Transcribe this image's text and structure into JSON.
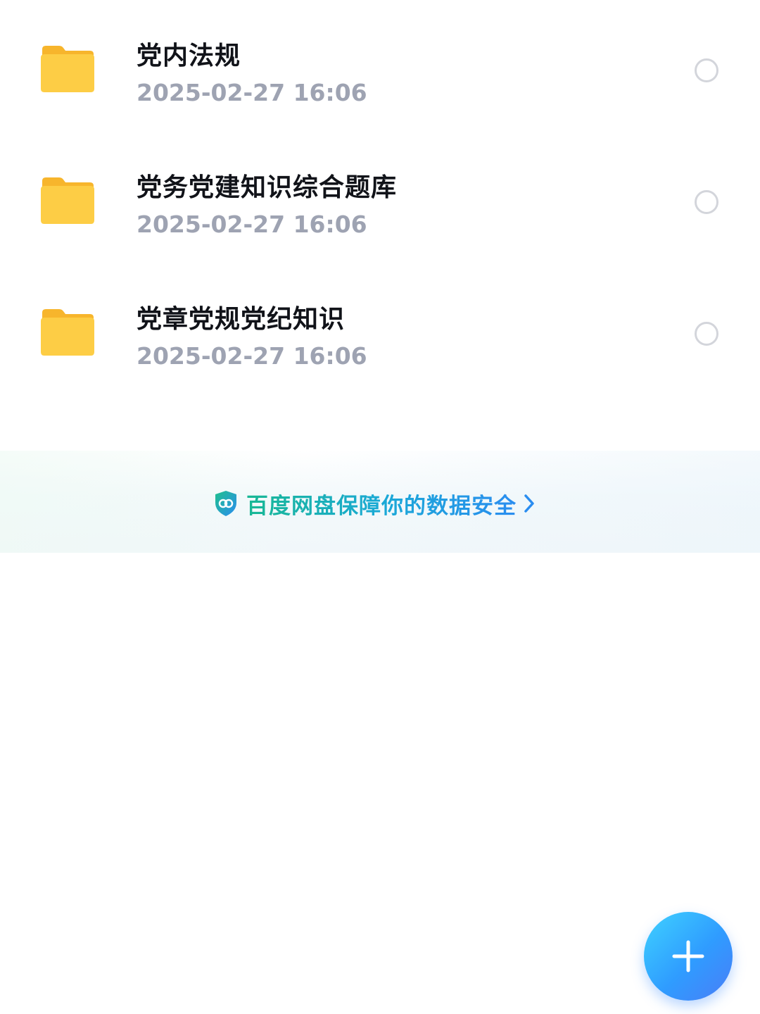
{
  "files": [
    {
      "name": "党内法规",
      "time": "2025-02-27  16:06",
      "icon": "folder-icon"
    },
    {
      "name": "党务党建知识综合题库",
      "time": "2025-02-27  16:06",
      "icon": "folder-icon"
    },
    {
      "name": "党章党规党纪知识",
      "time": "2025-02-27  16:06",
      "icon": "folder-icon"
    }
  ],
  "security_banner": {
    "text": "百度网盘保障你的数据安全",
    "icon": "shield-icon",
    "chevron": "chevron-right-icon"
  },
  "fab": {
    "icon": "plus-icon"
  },
  "colors": {
    "folder": "#fdc93a",
    "title": "#111319",
    "time": "#9ea3b2",
    "accent_green": "#19b894",
    "accent_blue": "#2a8df0",
    "fab": "#2f9cff"
  }
}
